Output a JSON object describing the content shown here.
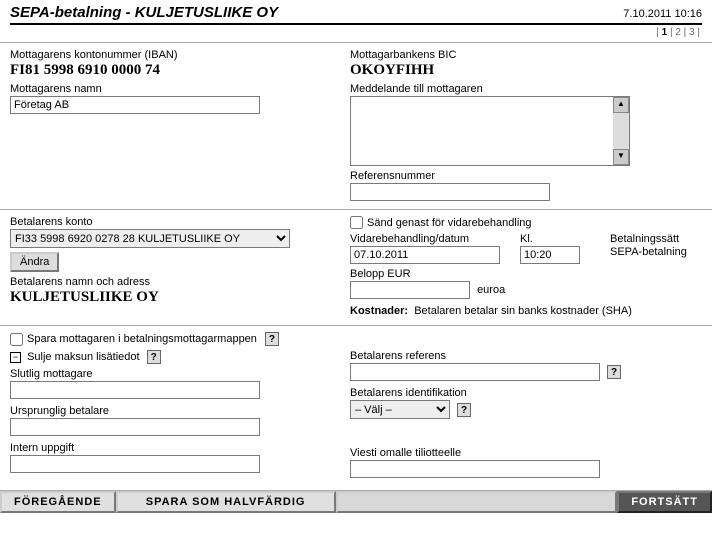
{
  "header": {
    "title": "SEPA-betalning - KULJETUSLIIKE OY",
    "datetime": "7.10.2011 10:16"
  },
  "pager": {
    "current": "1",
    "p2": "2",
    "p3": "3"
  },
  "recipient": {
    "iban_label": "Mottagarens kontonummer (IBAN)",
    "iban": "FI81 5998 6910 0000 74",
    "name_label": "Mottagarens namn",
    "name": "Företag AB",
    "bic_label": "Mottagarbankens BIC",
    "bic": "OKOYFIHH",
    "message_label": "Meddelande till mottagaren",
    "refnum_label": "Referensnummer"
  },
  "payer": {
    "account_label": "Betalarens konto",
    "account_selected": "FI33 5998 6920 0278 28 KULJETUSLIIKE OY",
    "change_btn": "Ändra",
    "name_label": "Betalarens namn och adress",
    "name": "KULJETUSLIIKE OY",
    "send_now_label": "Sänd genast för vidarebehandling",
    "date_label": "Vidarebehandling/datum",
    "date": "07.10.2011",
    "time_label": "Kl.",
    "time": "10:20",
    "method_label": "Betalningssätt",
    "method": "SEPA-betalning",
    "amount_label": "Belopp EUR",
    "amount_suffix": "euroa",
    "costs_label": "Kostnader:",
    "costs_text": "Betalaren betalar sin banks kostnader (SHA)"
  },
  "extras": {
    "save_recipient_label": "Spara mottagaren i betalningsmottagarmappen",
    "collapse_label": "Sulje maksun lisätiedot",
    "final_recipient_label": "Slutlig mottagare",
    "original_payer_label": "Ursprunglig betalare",
    "internal_label": "Intern uppgift",
    "payer_ref_label": "Betalarens referens",
    "payer_id_label": "Betalarens identifikation",
    "payer_id_selected": "– Välj –",
    "own_msg_label": "Viesti omalle tiliotteelle"
  },
  "footer": {
    "prev": "FÖREGÅENDE",
    "save_draft": "SPARA SOM HALVFÄRDIG",
    "continue": "FORTSÄTT"
  },
  "help": "?"
}
